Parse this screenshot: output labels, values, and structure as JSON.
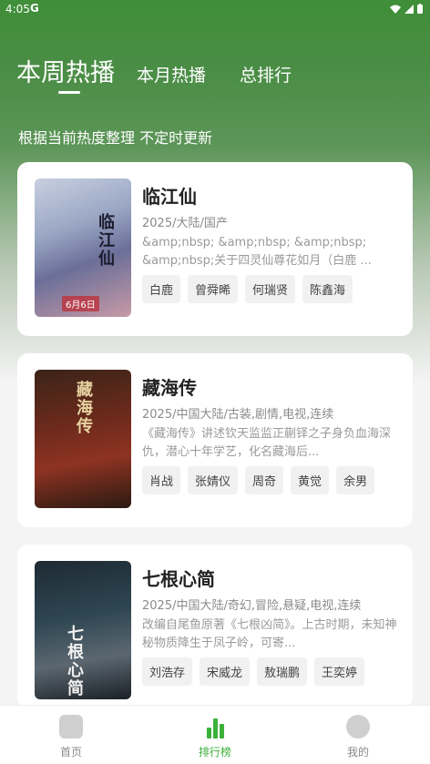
{
  "status_bar": {
    "time": "4:05",
    "carrier_glyph": "G"
  },
  "tabs": [
    {
      "label": "本周热播",
      "active": true
    },
    {
      "label": "本月热播",
      "active": false
    },
    {
      "label": "总排行",
      "active": false
    }
  ],
  "subtitle": "根据当前热度整理 不定时更新",
  "shows": [
    {
      "title": "临江仙",
      "meta": "2025/大陆/国产",
      "desc": "&amp;nbsp; &amp;nbsp; &amp;nbsp; &amp;nbsp;关于四灵仙尊花如月（白鹿 ...",
      "tags": [
        "白鹿",
        "曾舜晞",
        "何瑞贤",
        "陈鑫海"
      ],
      "poster_text": "临江仙",
      "poster_date": "6月6日"
    },
    {
      "title": "藏海传",
      "meta": "2025/中国大陆/古装,剧情,电视,连续",
      "desc": "《藏海传》讲述钦天监监正蒯铎之子身负血海深仇，潜心十年学艺，化名藏海后...",
      "tags": [
        "肖战",
        "张婧仪",
        "周奇",
        "黄觉",
        "余男"
      ],
      "poster_text": "藏海传"
    },
    {
      "title": "七根心简",
      "meta": "2025/中国大陆/奇幻,冒险,悬疑,电视,连续",
      "desc": "改编自尾鱼原著《七根凶简》。上古时期，未知神秘物质降生于凤子岭，可寄...",
      "tags": [
        "刘浩存",
        "宋威龙",
        "敖瑞鹏",
        "王奕婷"
      ],
      "poster_text": "七根心简"
    }
  ],
  "bottom_nav": [
    {
      "label": "首页",
      "icon": "home-icon",
      "active": false
    },
    {
      "label": "排行榜",
      "icon": "bar-chart-icon",
      "active": true
    },
    {
      "label": "我的",
      "icon": "profile-icon",
      "active": false
    }
  ],
  "colors": {
    "accent": "#3bb03b",
    "header_green": "#3f8e38"
  }
}
